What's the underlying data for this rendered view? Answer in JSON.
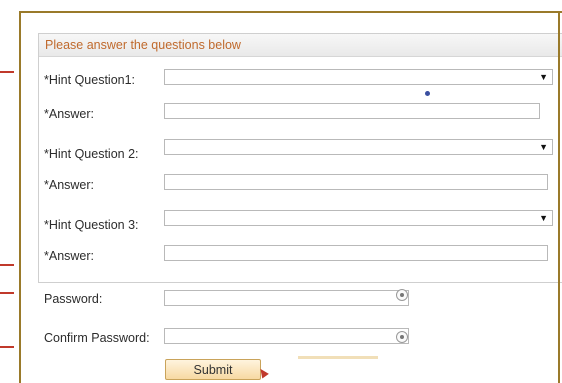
{
  "section": {
    "header": "Please answer the questions below"
  },
  "hints": [
    {
      "question_label": "*Hint Question1:",
      "question_value": "",
      "answer_label": "*Answer:",
      "answer_value": ""
    },
    {
      "question_label": "*Hint Question 2:",
      "question_value": "",
      "answer_label": "*Answer:",
      "answer_value": ""
    },
    {
      "question_label": "*Hint Question 3:",
      "question_value": "",
      "answer_label": "*Answer:",
      "answer_value": ""
    }
  ],
  "password": {
    "label": "Password:",
    "value": ""
  },
  "confirm_password": {
    "label": "Confirm Password:",
    "value": ""
  },
  "submit": {
    "label": "Submit"
  },
  "icons": {
    "dropdown": "chevron-down-icon",
    "reveal": "eye-icon"
  },
  "colors": {
    "frame": "#9a7a2a",
    "header_text": "#c06a2d",
    "button": "#f7d9a2"
  }
}
